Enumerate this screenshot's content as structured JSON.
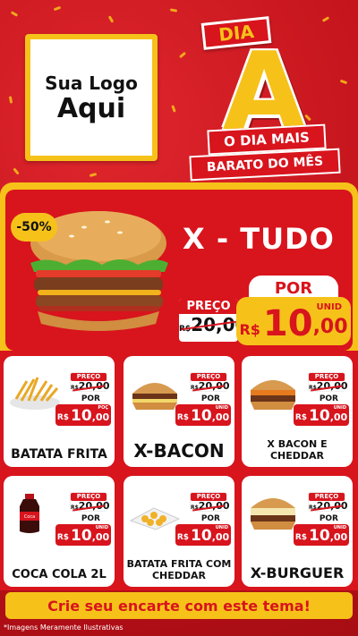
{
  "logo": {
    "line1": "Sua Logo",
    "line2": "Aqui"
  },
  "campaign": {
    "dia": "DIA",
    "letter": "A",
    "line1": "O DIA MAIS",
    "line2": "BARATO DO MÊS"
  },
  "featured": {
    "discount": "-50%",
    "name": "X - TUDO",
    "old_label": "PREÇO",
    "old_currency": "R$",
    "old_price": "20,00",
    "por_label": "POR",
    "currency": "R$",
    "price_int": "10",
    "price_dec": ",00",
    "unit": "UNID"
  },
  "products": [
    {
      "name": "BATATA FRITA",
      "old_label": "PREÇO",
      "old_currency": "R$",
      "old_price": "20,00",
      "por": "POR",
      "currency": "R$",
      "price_int": "10",
      "price_dec": ",00",
      "unit": "POÇ"
    },
    {
      "name": "X-BACON",
      "old_label": "PREÇO",
      "old_currency": "R$",
      "old_price": "20,00",
      "por": "POR",
      "currency": "R$",
      "price_int": "10",
      "price_dec": ",00",
      "unit": "UNID"
    },
    {
      "name": "X BACON E CHEDDAR",
      "old_label": "PREÇO",
      "old_currency": "R$",
      "old_price": "20,00",
      "por": "POR",
      "currency": "R$",
      "price_int": "10",
      "price_dec": ",00",
      "unit": "UNID"
    },
    {
      "name": "COCA COLA 2L",
      "old_label": "PREÇO",
      "old_currency": "R$",
      "old_price": "20,00",
      "por": "POR",
      "currency": "R$",
      "price_int": "10",
      "price_dec": ",00",
      "unit": "UNID"
    },
    {
      "name": "BATATA FRITA COM CHEDDAR",
      "old_label": "PREÇO",
      "old_currency": "R$",
      "old_price": "20,00",
      "por": "POR",
      "currency": "R$",
      "price_int": "10",
      "price_dec": ",00",
      "unit": "UNID"
    },
    {
      "name": "X-BURGUER",
      "old_label": "PREÇO",
      "old_currency": "R$",
      "old_price": "20,00",
      "por": "POR",
      "currency": "R$",
      "price_int": "10",
      "price_dec": ",00",
      "unit": "UNID"
    }
  ],
  "cta": "Crie seu encarte com este tema!",
  "footnote": "*Imagens Meramente Ilustrativas",
  "colors": {
    "red": "#d8141d",
    "yellow": "#f6c21a"
  }
}
